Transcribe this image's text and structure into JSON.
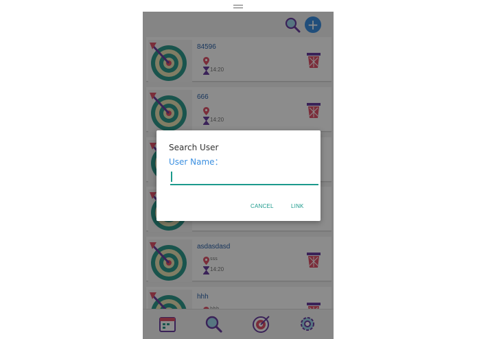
{
  "app": {
    "accent": "#3b8fe0",
    "dialog_accent": "#1b9a8c"
  },
  "header": {
    "search_icon": "search-user-icon",
    "add_icon": "add-icon",
    "add_label": "+"
  },
  "list": {
    "items": [
      {
        "name": "84596",
        "location": "",
        "time": "14:20"
      },
      {
        "name": "666",
        "location": "",
        "time": "14:20"
      },
      {
        "name": "",
        "location": "",
        "time": ""
      },
      {
        "name": "",
        "location": "",
        "time": ""
      },
      {
        "name": "asdasdasd",
        "location": "sss",
        "time": "14:20"
      },
      {
        "name": "hhh",
        "location": "hhh",
        "time": ""
      }
    ]
  },
  "bottom_nav": {
    "items": [
      "calendar-icon",
      "search-icon",
      "target-icon",
      "settings-icon"
    ]
  },
  "dialog": {
    "title": "Search User",
    "label": "User Name：",
    "input_value": "",
    "cancel_label": "CANCEL",
    "link_label": "LINK"
  }
}
